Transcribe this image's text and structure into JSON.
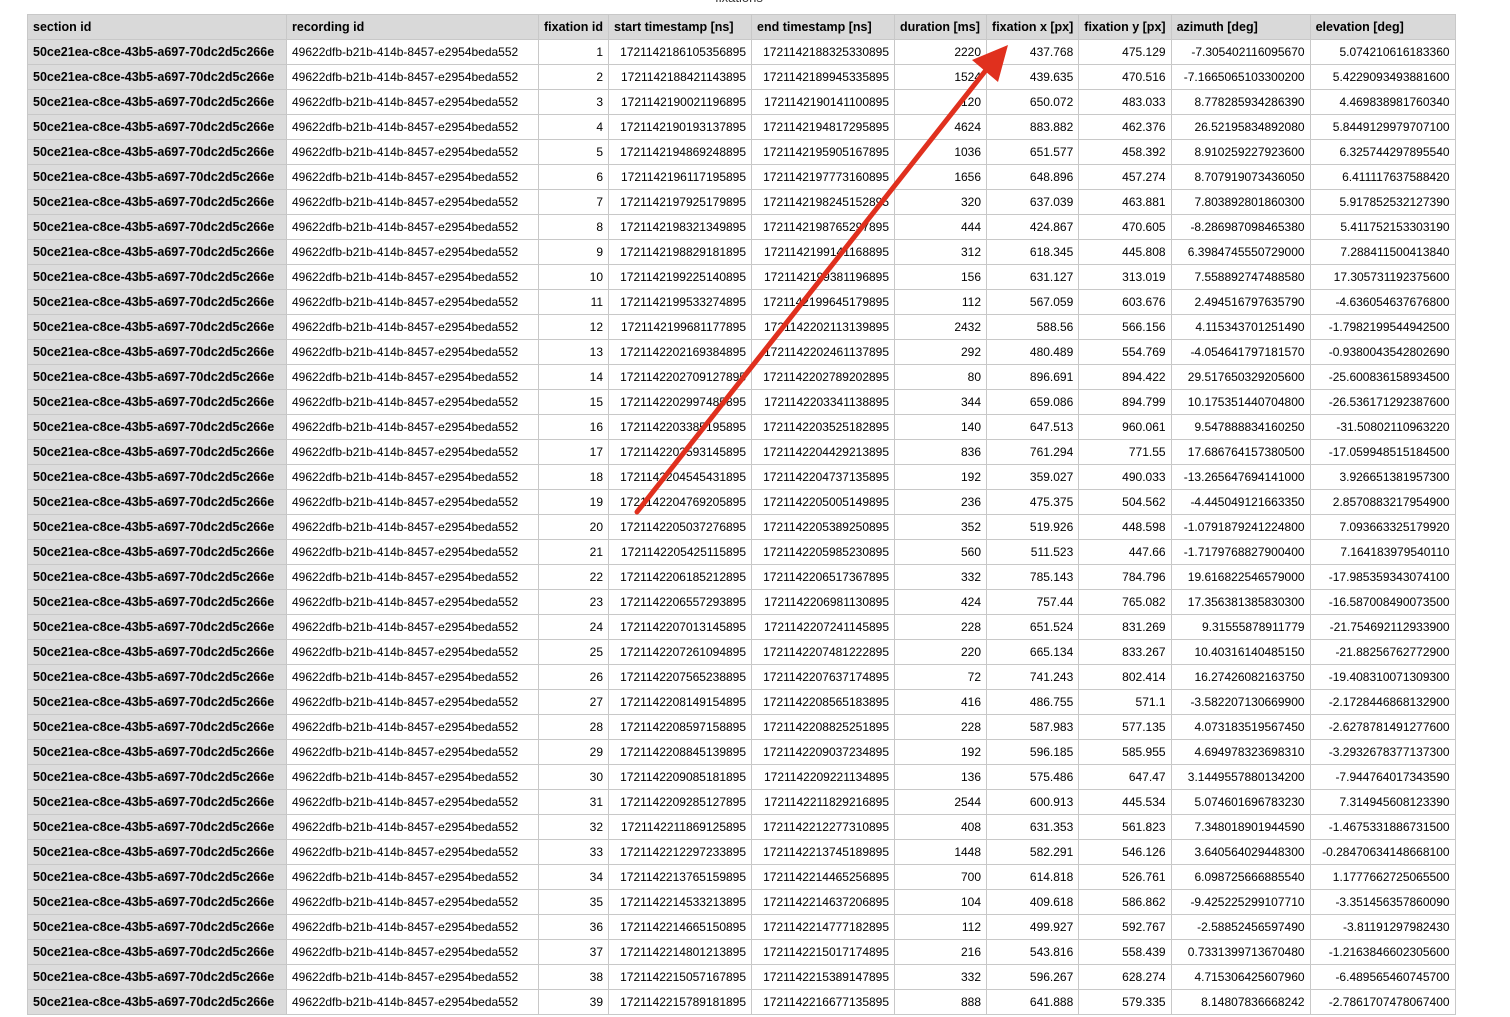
{
  "sheet": {
    "title": "fixations"
  },
  "table": {
    "columns": [
      "section id",
      "recording id",
      "fixation id",
      "start timestamp [ns]",
      "end timestamp [ns]",
      "duration [ms]",
      "fixation x [px]",
      "fixation y [px]",
      "azimuth [deg]",
      "elevation [deg]"
    ],
    "rows": [
      [
        "50ce21ea-c8ce-43b5-a697-70dc2d5c266e",
        "49622dfb-b21b-414b-8457-e2954beda552",
        "1",
        "1721142186105356895",
        "1721142188325330895",
        "2220",
        "437.768",
        "475.129",
        "-7.305402116095670",
        "5.074210616183360"
      ],
      [
        "50ce21ea-c8ce-43b5-a697-70dc2d5c266e",
        "49622dfb-b21b-414b-8457-e2954beda552",
        "2",
        "1721142188421143895",
        "1721142189945335895",
        "1524",
        "439.635",
        "470.516",
        "-7.1665065103300200",
        "5.4229093493881600"
      ],
      [
        "50ce21ea-c8ce-43b5-a697-70dc2d5c266e",
        "49622dfb-b21b-414b-8457-e2954beda552",
        "3",
        "1721142190021196895",
        "1721142190141100895",
        "120",
        "650.072",
        "483.033",
        "8.778285934286390",
        "4.469838981760340"
      ],
      [
        "50ce21ea-c8ce-43b5-a697-70dc2d5c266e",
        "49622dfb-b21b-414b-8457-e2954beda552",
        "4",
        "1721142190193137895",
        "1721142194817295895",
        "4624",
        "883.882",
        "462.376",
        "26.52195834892080",
        "5.8449129979707100"
      ],
      [
        "50ce21ea-c8ce-43b5-a697-70dc2d5c266e",
        "49622dfb-b21b-414b-8457-e2954beda552",
        "5",
        "1721142194869248895",
        "1721142195905167895",
        "1036",
        "651.577",
        "458.392",
        "8.910259227923600",
        "6.325744297895540"
      ],
      [
        "50ce21ea-c8ce-43b5-a697-70dc2d5c266e",
        "49622dfb-b21b-414b-8457-e2954beda552",
        "6",
        "1721142196117195895",
        "1721142197773160895",
        "1656",
        "648.896",
        "457.274",
        "8.707919073436050",
        "6.411117637588420"
      ],
      [
        "50ce21ea-c8ce-43b5-a697-70dc2d5c266e",
        "49622dfb-b21b-414b-8457-e2954beda552",
        "7",
        "1721142197925179895",
        "1721142198245152895",
        "320",
        "637.039",
        "463.881",
        "7.803892801860300",
        "5.917852532127390"
      ],
      [
        "50ce21ea-c8ce-43b5-a697-70dc2d5c266e",
        "49622dfb-b21b-414b-8457-e2954beda552",
        "8",
        "1721142198321349895",
        "1721142198765297895",
        "444",
        "424.867",
        "470.605",
        "-8.286987098465380",
        "5.411752153303190"
      ],
      [
        "50ce21ea-c8ce-43b5-a697-70dc2d5c266e",
        "49622dfb-b21b-414b-8457-e2954beda552",
        "9",
        "1721142198829181895",
        "1721142199141168895",
        "312",
        "618.345",
        "445.808",
        "6.3984745550729000",
        "7.288411500413840"
      ],
      [
        "50ce21ea-c8ce-43b5-a697-70dc2d5c266e",
        "49622dfb-b21b-414b-8457-e2954beda552",
        "10",
        "1721142199225140895",
        "1721142199381196895",
        "156",
        "631.127",
        "313.019",
        "7.558892747488580",
        "17.305731192375600"
      ],
      [
        "50ce21ea-c8ce-43b5-a697-70dc2d5c266e",
        "49622dfb-b21b-414b-8457-e2954beda552",
        "11",
        "1721142199533274895",
        "1721142199645179895",
        "112",
        "567.059",
        "603.676",
        "2.494516797635790",
        "-4.636054637676800"
      ],
      [
        "50ce21ea-c8ce-43b5-a697-70dc2d5c266e",
        "49622dfb-b21b-414b-8457-e2954beda552",
        "12",
        "1721142199681177895",
        "1721142202113139895",
        "2432",
        "588.56",
        "566.156",
        "4.115343701251490",
        "-1.7982199544942500"
      ],
      [
        "50ce21ea-c8ce-43b5-a697-70dc2d5c266e",
        "49622dfb-b21b-414b-8457-e2954beda552",
        "13",
        "1721142202169384895",
        "1721142202461137895",
        "292",
        "480.489",
        "554.769",
        "-4.054641797181570",
        "-0.9380043542802690"
      ],
      [
        "50ce21ea-c8ce-43b5-a697-70dc2d5c266e",
        "49622dfb-b21b-414b-8457-e2954beda552",
        "14",
        "1721142202709127895",
        "1721142202789202895",
        "80",
        "896.691",
        "894.422",
        "29.517650329205600",
        "-25.600836158934500"
      ],
      [
        "50ce21ea-c8ce-43b5-a697-70dc2d5c266e",
        "49622dfb-b21b-414b-8457-e2954beda552",
        "15",
        "1721142202997485895",
        "1721142203341138895",
        "344",
        "659.086",
        "894.799",
        "10.175351440704800",
        "-26.536171292387600"
      ],
      [
        "50ce21ea-c8ce-43b5-a697-70dc2d5c266e",
        "49622dfb-b21b-414b-8457-e2954beda552",
        "16",
        "1721142203385195895",
        "1721142203525182895",
        "140",
        "647.513",
        "960.061",
        "9.547888834160250",
        "-31.50802110963220"
      ],
      [
        "50ce21ea-c8ce-43b5-a697-70dc2d5c266e",
        "49622dfb-b21b-414b-8457-e2954beda552",
        "17",
        "1721142203593145895",
        "1721142204429213895",
        "836",
        "761.294",
        "771.55",
        "17.686764157380500",
        "-17.059948515184500"
      ],
      [
        "50ce21ea-c8ce-43b5-a697-70dc2d5c266e",
        "49622dfb-b21b-414b-8457-e2954beda552",
        "18",
        "1721142204545431895",
        "1721142204737135895",
        "192",
        "359.027",
        "490.033",
        "-13.265647694141000",
        "3.926651381957300"
      ],
      [
        "50ce21ea-c8ce-43b5-a697-70dc2d5c266e",
        "49622dfb-b21b-414b-8457-e2954beda552",
        "19",
        "1721142204769205895",
        "1721142205005149895",
        "236",
        "475.375",
        "504.562",
        "-4.445049121663350",
        "2.8570883217954900"
      ],
      [
        "50ce21ea-c8ce-43b5-a697-70dc2d5c266e",
        "49622dfb-b21b-414b-8457-e2954beda552",
        "20",
        "1721142205037276895",
        "1721142205389250895",
        "352",
        "519.926",
        "448.598",
        "-1.0791879241224800",
        "7.093663325179920"
      ],
      [
        "50ce21ea-c8ce-43b5-a697-70dc2d5c266e",
        "49622dfb-b21b-414b-8457-e2954beda552",
        "21",
        "1721142205425115895",
        "1721142205985230895",
        "560",
        "511.523",
        "447.66",
        "-1.7179768827900400",
        "7.164183979540110"
      ],
      [
        "50ce21ea-c8ce-43b5-a697-70dc2d5c266e",
        "49622dfb-b21b-414b-8457-e2954beda552",
        "22",
        "1721142206185212895",
        "1721142206517367895",
        "332",
        "785.143",
        "784.796",
        "19.616822546579000",
        "-17.985359343074100"
      ],
      [
        "50ce21ea-c8ce-43b5-a697-70dc2d5c266e",
        "49622dfb-b21b-414b-8457-e2954beda552",
        "23",
        "1721142206557293895",
        "1721142206981130895",
        "424",
        "757.44",
        "765.082",
        "17.356381385830300",
        "-16.587008490073500"
      ],
      [
        "50ce21ea-c8ce-43b5-a697-70dc2d5c266e",
        "49622dfb-b21b-414b-8457-e2954beda552",
        "24",
        "1721142207013145895",
        "1721142207241145895",
        "228",
        "651.524",
        "831.269",
        "9.31555878911779",
        "-21.754692112933900"
      ],
      [
        "50ce21ea-c8ce-43b5-a697-70dc2d5c266e",
        "49622dfb-b21b-414b-8457-e2954beda552",
        "25",
        "1721142207261094895",
        "1721142207481222895",
        "220",
        "665.134",
        "833.267",
        "10.40316140485150",
        "-21.88256762772900"
      ],
      [
        "50ce21ea-c8ce-43b5-a697-70dc2d5c266e",
        "49622dfb-b21b-414b-8457-e2954beda552",
        "26",
        "1721142207565238895",
        "1721142207637174895",
        "72",
        "741.243",
        "802.414",
        "16.27426082163750",
        "-19.408310071309300"
      ],
      [
        "50ce21ea-c8ce-43b5-a697-70dc2d5c266e",
        "49622dfb-b21b-414b-8457-e2954beda552",
        "27",
        "1721142208149154895",
        "1721142208565183895",
        "416",
        "486.755",
        "571.1",
        "-3.582207130669900",
        "-2.1728446868132900"
      ],
      [
        "50ce21ea-c8ce-43b5-a697-70dc2d5c266e",
        "49622dfb-b21b-414b-8457-e2954beda552",
        "28",
        "1721142208597158895",
        "1721142208825251895",
        "228",
        "587.983",
        "577.135",
        "4.073183519567450",
        "-2.6278781491277600"
      ],
      [
        "50ce21ea-c8ce-43b5-a697-70dc2d5c266e",
        "49622dfb-b21b-414b-8457-e2954beda552",
        "29",
        "1721142208845139895",
        "1721142209037234895",
        "192",
        "596.185",
        "585.955",
        "4.694978323698310",
        "-3.2932678377137300"
      ],
      [
        "50ce21ea-c8ce-43b5-a697-70dc2d5c266e",
        "49622dfb-b21b-414b-8457-e2954beda552",
        "30",
        "1721142209085181895",
        "1721142209221134895",
        "136",
        "575.486",
        "647.47",
        "3.1449557880134200",
        "-7.944764017343590"
      ],
      [
        "50ce21ea-c8ce-43b5-a697-70dc2d5c266e",
        "49622dfb-b21b-414b-8457-e2954beda552",
        "31",
        "1721142209285127895",
        "1721142211829216895",
        "2544",
        "600.913",
        "445.534",
        "5.074601696783230",
        "7.314945608123390"
      ],
      [
        "50ce21ea-c8ce-43b5-a697-70dc2d5c266e",
        "49622dfb-b21b-414b-8457-e2954beda552",
        "32",
        "1721142211869125895",
        "1721142212277310895",
        "408",
        "631.353",
        "561.823",
        "7.348018901944590",
        "-1.4675331886731500"
      ],
      [
        "50ce21ea-c8ce-43b5-a697-70dc2d5c266e",
        "49622dfb-b21b-414b-8457-e2954beda552",
        "33",
        "1721142212297233895",
        "1721142213745189895",
        "1448",
        "582.291",
        "546.126",
        "3.640564029448300",
        "-0.28470634148668100"
      ],
      [
        "50ce21ea-c8ce-43b5-a697-70dc2d5c266e",
        "49622dfb-b21b-414b-8457-e2954beda552",
        "34",
        "1721142213765159895",
        "1721142214465256895",
        "700",
        "614.818",
        "526.761",
        "6.098725666885540",
        "1.1777662725065500"
      ],
      [
        "50ce21ea-c8ce-43b5-a697-70dc2d5c266e",
        "49622dfb-b21b-414b-8457-e2954beda552",
        "35",
        "1721142214533213895",
        "1721142214637206895",
        "104",
        "409.618",
        "586.862",
        "-9.425225299107710",
        "-3.351456357860090"
      ],
      [
        "50ce21ea-c8ce-43b5-a697-70dc2d5c266e",
        "49622dfb-b21b-414b-8457-e2954beda552",
        "36",
        "1721142214665150895",
        "1721142214777182895",
        "112",
        "499.927",
        "592.767",
        "-2.58852456597490",
        "-3.81191297982430"
      ],
      [
        "50ce21ea-c8ce-43b5-a697-70dc2d5c266e",
        "49622dfb-b21b-414b-8457-e2954beda552",
        "37",
        "1721142214801213895",
        "1721142215017174895",
        "216",
        "543.816",
        "558.439",
        "0.7331399713670480",
        "-1.2163846602305600"
      ],
      [
        "50ce21ea-c8ce-43b5-a697-70dc2d5c266e",
        "49622dfb-b21b-414b-8457-e2954beda552",
        "38",
        "1721142215057167895",
        "1721142215389147895",
        "332",
        "596.267",
        "628.274",
        "4.715306425607960",
        "-6.489565460745700"
      ],
      [
        "50ce21ea-c8ce-43b5-a697-70dc2d5c266e",
        "49622dfb-b21b-414b-8457-e2954beda552",
        "39",
        "1721142215789181895",
        "1721142216677135895",
        "888",
        "641.888",
        "579.335",
        "8.14807836668242",
        "-2.7861707478067400"
      ]
    ]
  },
  "annotation": {
    "arrow_color": "#e0301e"
  }
}
